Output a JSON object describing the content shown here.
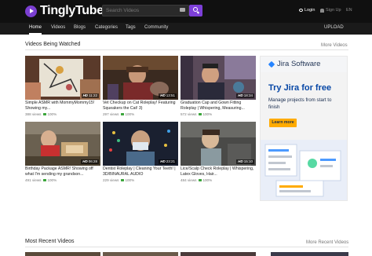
{
  "header": {
    "logo_text": "TinglyTube",
    "search_placeholder": "Search Videos",
    "login_label": "Login",
    "signup_label": "Sign Up",
    "language": "EN"
  },
  "nav": {
    "items": [
      {
        "label": "Home",
        "active": true
      },
      {
        "label": "Videos",
        "active": false
      },
      {
        "label": "Blogs",
        "active": false
      },
      {
        "label": "Categories",
        "active": false
      },
      {
        "label": "Tags",
        "active": false
      },
      {
        "label": "Community",
        "active": false
      }
    ],
    "upload_label": "UPLOAD"
  },
  "watched": {
    "title": "Videos Being Watched",
    "more_label": "More Videos",
    "videos": [
      {
        "title": "Simple ASMR with MommyMommy15! Showing my...",
        "duration": "11:22",
        "views": "388 views",
        "likes": "100%"
      },
      {
        "title": "Vet Checkup on Cat Roleplay! Featuring Squeakers the Cat! 3)",
        "duration": "13:51",
        "views": "297 views",
        "likes": "100%"
      },
      {
        "title": "Graduation Cap and Gown Fitting Roleplay | Whispering, Measuring...",
        "duration": "18:34",
        "views": "572 views",
        "likes": "100%"
      },
      {
        "title": "Birthday Package ASMR! Showing off what I'm sending my grandson...",
        "duration": "06:28",
        "views": "491 views",
        "likes": "100%"
      },
      {
        "title": "Dentist Roleplay | Cleaning Your Teeth! | 3D/BINAURAL AUDIO",
        "duration": "23:21",
        "views": "229 views",
        "likes": "100%"
      },
      {
        "title": "Lice/Scalp Check Roleplay | Whispering, Latex Gloves, Hair...",
        "duration": "15:10",
        "views": "484 views",
        "likes": "100%"
      }
    ]
  },
  "recent": {
    "title": "Most Recent Videos",
    "more_label": "More Recent Videos"
  },
  "ad": {
    "brand": "Jira Software",
    "tagline": "Try Jira for free",
    "body": "Manage projects from start to finish",
    "button_label": "Learn more"
  },
  "colors": {
    "accent": "#7d3fd8",
    "header_bg": "#101010",
    "nav_bg": "#1a1a1a",
    "like_green": "#3ca63c",
    "jira_blue": "#0747a6",
    "ad_button": "#ffab00"
  }
}
